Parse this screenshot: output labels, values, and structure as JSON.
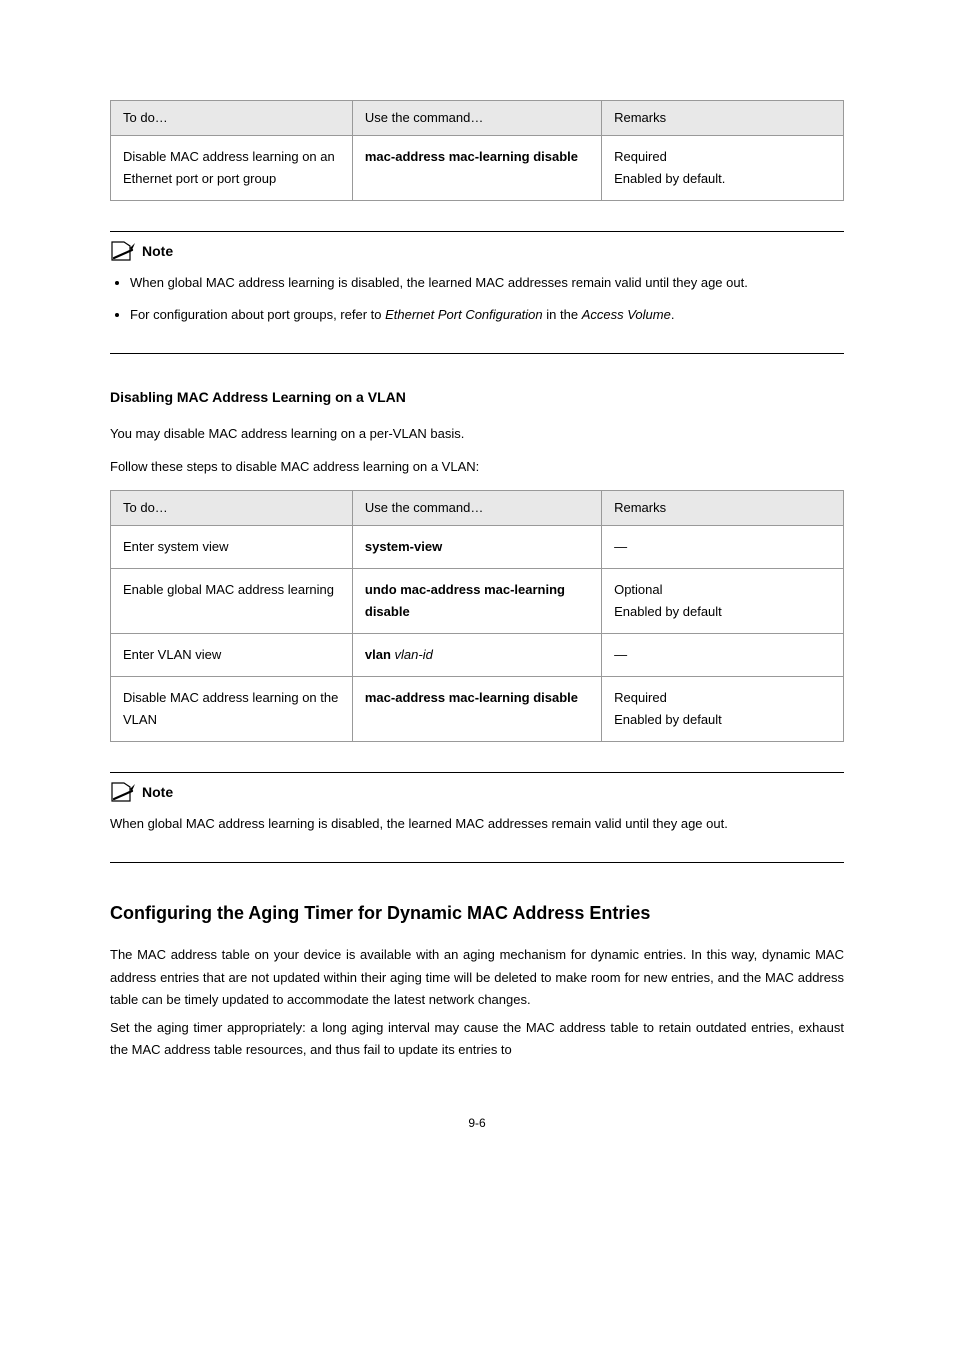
{
  "table1": {
    "headers": [
      "To do…",
      "Use the command…",
      "Remarks"
    ],
    "row": {
      "todo": "Disable MAC address learning on an Ethernet port or port group",
      "command": "mac-address mac-learning disable",
      "remarks_line1": "Required",
      "remarks_line2": "Enabled by default."
    }
  },
  "note1": {
    "label": "Note",
    "bullet1": "When global MAC address learning is disabled, the learned MAC addresses remain valid until they age out.",
    "bullet2_a": "For configuration about port groups, refer to",
    "bullet2_b": "Ethernet Port Configuration",
    "bullet2_c": "in the",
    "bullet2_d": "Access Volume",
    "bullet2_e": "."
  },
  "section_heading_1": "Disabling MAC Address Learning on a VLAN",
  "intro_para_1": "You may disable MAC address learning on a per-VLAN basis.",
  "intro_para_2": "Follow these steps to disable MAC address learning on a VLAN:",
  "table2": {
    "headers": [
      "To do…",
      "Use the command…",
      "Remarks"
    ],
    "rows": [
      {
        "todo": "Enter system view",
        "command": "system-view",
        "remarks": "—"
      },
      {
        "todo": "Enable global MAC address learning",
        "command": "undo mac-address mac-learning disable",
        "remarks_line1": "Optional",
        "remarks_line2": "Enabled by default"
      },
      {
        "todo": "Enter VLAN view",
        "command": "vlan vlan-id",
        "remarks": "—"
      },
      {
        "todo": "Disable MAC address learning on the VLAN",
        "command": "mac-address mac-learning disable",
        "remarks_line1": "Required",
        "remarks_line2": "Enabled by default"
      }
    ]
  },
  "note2": {
    "label": "Note",
    "text": "When global MAC address learning is disabled, the learned MAC addresses remain valid until they age out."
  },
  "big_heading": "Configuring the Aging Timer for Dynamic MAC Address Entries",
  "aging_para_1": "The MAC address table on your device is available with an aging mechanism for dynamic entries. In this way, dynamic MAC address entries that are not updated within their aging time will be deleted to make room for new entries, and the MAC address table can be timely updated to accommodate the latest network changes.",
  "aging_para_2": "Set the aging timer appropriately: a long aging interval may cause the MAC address table to retain outdated entries, exhaust the MAC address table resources, and thus fail to update its entries to",
  "page_number": "9-6"
}
